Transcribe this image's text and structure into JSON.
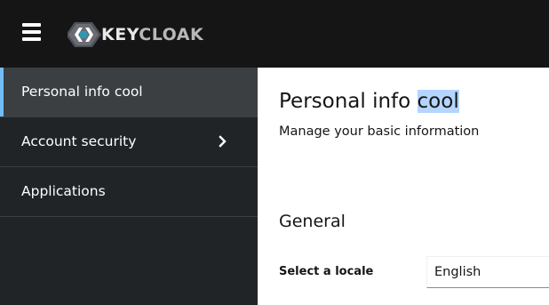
{
  "header": {
    "menu_icon": "hamburger-menu-icon",
    "logo_text_key": "KEY",
    "logo_text_cloak": "CLOAK",
    "background_color": "#151515"
  },
  "sidebar": {
    "items": [
      {
        "label": "Personal info cool",
        "active": true
      },
      {
        "label": "Account security",
        "expandable": true,
        "icon": "chevron-right-icon"
      },
      {
        "label": "Applications"
      }
    ],
    "background_color": "#212427",
    "active_color": "#3c3f42",
    "accent_color": "#73bcf7"
  },
  "main": {
    "title_prefix": "Personal info ",
    "title_highlight": "cool",
    "subtitle": "Manage your basic information",
    "section_title": "General",
    "locale_label": "Select a locale",
    "locale_value": "English"
  }
}
